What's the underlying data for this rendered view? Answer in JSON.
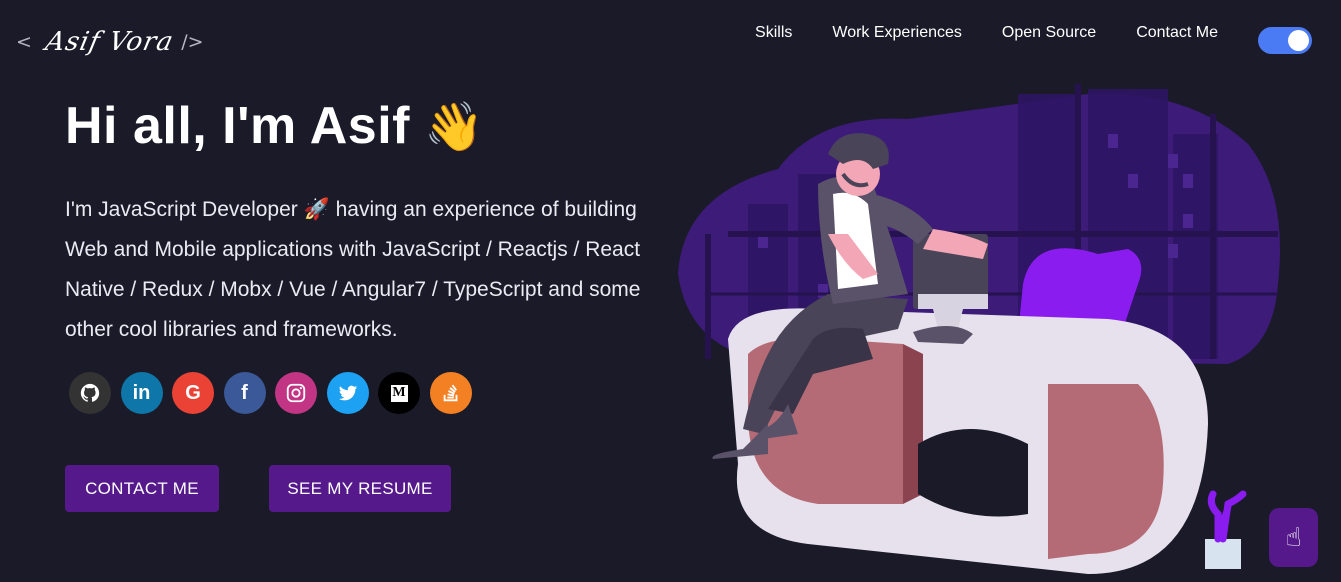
{
  "header": {
    "logo": {
      "open": "<",
      "name": "Asif Vora",
      "close": "/>"
    },
    "nav": [
      "Skills",
      "Work Experiences",
      "Open Source",
      "Contact Me"
    ],
    "dark_mode": true
  },
  "hero": {
    "greeting": "Hi all, I'm Asif",
    "wave_emoji": "👋",
    "subtitle": "I'm JavaScript Developer 🚀 having an experience of building Web and Mobile applications with JavaScript / Reactjs / React Native / Redux / Mobx / Vue / Angular7 / TypeScript and some other cool libraries and frameworks."
  },
  "social": [
    {
      "icon": "github-icon",
      "glyph": "⌘",
      "color": "#333333"
    },
    {
      "icon": "linkedin-icon",
      "glyph": "in",
      "color": "#0e76a8"
    },
    {
      "icon": "google-icon",
      "glyph": "G",
      "color": "#ea4335"
    },
    {
      "icon": "facebook-icon",
      "glyph": "f",
      "color": "#3b5998"
    },
    {
      "icon": "instagram-icon",
      "glyph": "◎",
      "color": "#c13584"
    },
    {
      "icon": "twitter-icon",
      "glyph": "✦",
      "color": "#1da1f2"
    },
    {
      "icon": "medium-icon",
      "glyph": "M",
      "color": "#000000"
    },
    {
      "icon": "stackoverflow-icon",
      "glyph": "≡",
      "color": "#f48024"
    }
  ],
  "buttons": {
    "contact": "CONTACT ME",
    "resume": "SEE MY RESUME"
  },
  "colors": {
    "background": "#1b1a29",
    "accent": "#55198b",
    "toggle": "#4a7bf4"
  },
  "scroll_top_icon": "pointing-hand-icon"
}
